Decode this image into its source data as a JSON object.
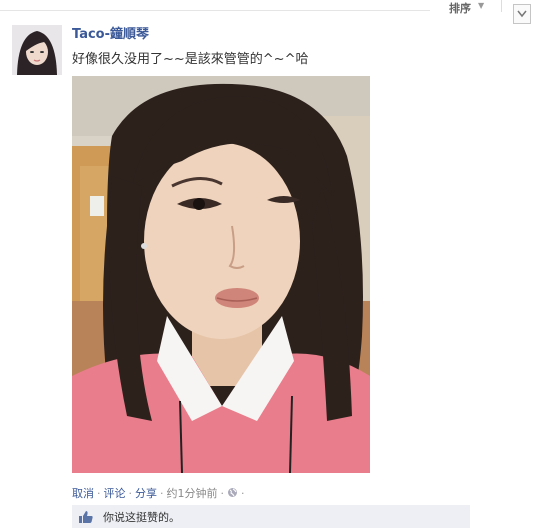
{
  "sort": {
    "label": "排序"
  },
  "post": {
    "author": "Taco-鐘順琴",
    "message": "好像很久没用了~~是該來管管的^~^哈",
    "actions": {
      "unlike": "取消",
      "comment": "评论",
      "share": "分享",
      "time": "约1分钟前"
    },
    "like_text": "你说这挺赞的。"
  },
  "icons": [
    "chevron-down-icon",
    "globe-icon",
    "thumbs-up-icon"
  ],
  "colors": {
    "link": "#3b5998",
    "like_bar": "#edeff4"
  }
}
